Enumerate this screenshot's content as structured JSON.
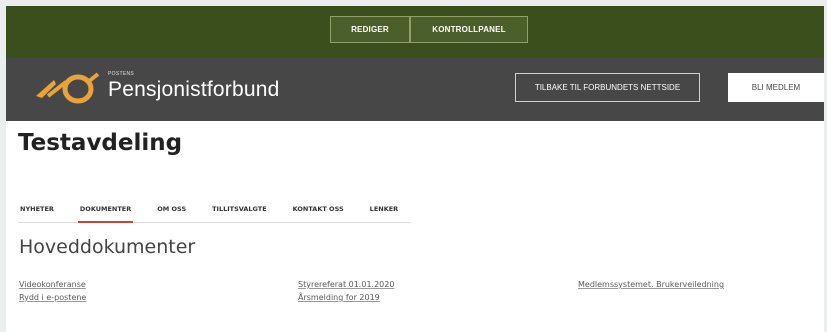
{
  "admin_bar": {
    "edit_label": "REDIGER",
    "control_panel_label": "KONTROLLPANEL"
  },
  "brand": {
    "small_text": "POSTENS",
    "name": "Pensjonistforbund",
    "logo_color": "#e8a43a"
  },
  "header_buttons": {
    "back_label": "TILBAKE TIL FORBUNDETS NETTSIDE",
    "join_label": "BLI MEDLEM"
  },
  "page": {
    "title": "Testavdeling"
  },
  "tabs": [
    {
      "label": "NYHETER",
      "active": false
    },
    {
      "label": "DOKUMENTER",
      "active": true
    },
    {
      "label": "OM OSS",
      "active": false
    },
    {
      "label": "TILLITSVALGTE",
      "active": false
    },
    {
      "label": "KONTAKT OSS",
      "active": false
    },
    {
      "label": "LENKER",
      "active": false
    }
  ],
  "documents": {
    "heading": "Hoveddokumenter",
    "columns": [
      [
        "Videokonferanse",
        "Rydd i e-postene"
      ],
      [
        "Styrereferat 01.01.2020",
        "Årsmelding for 2019"
      ],
      [
        "Medlemssystemet. Brukerveiledning"
      ]
    ]
  },
  "colors": {
    "admin_bar_bg": "#3b4f1c",
    "brand_bar_bg": "#474747",
    "active_tab_underline": "#c4473a"
  }
}
